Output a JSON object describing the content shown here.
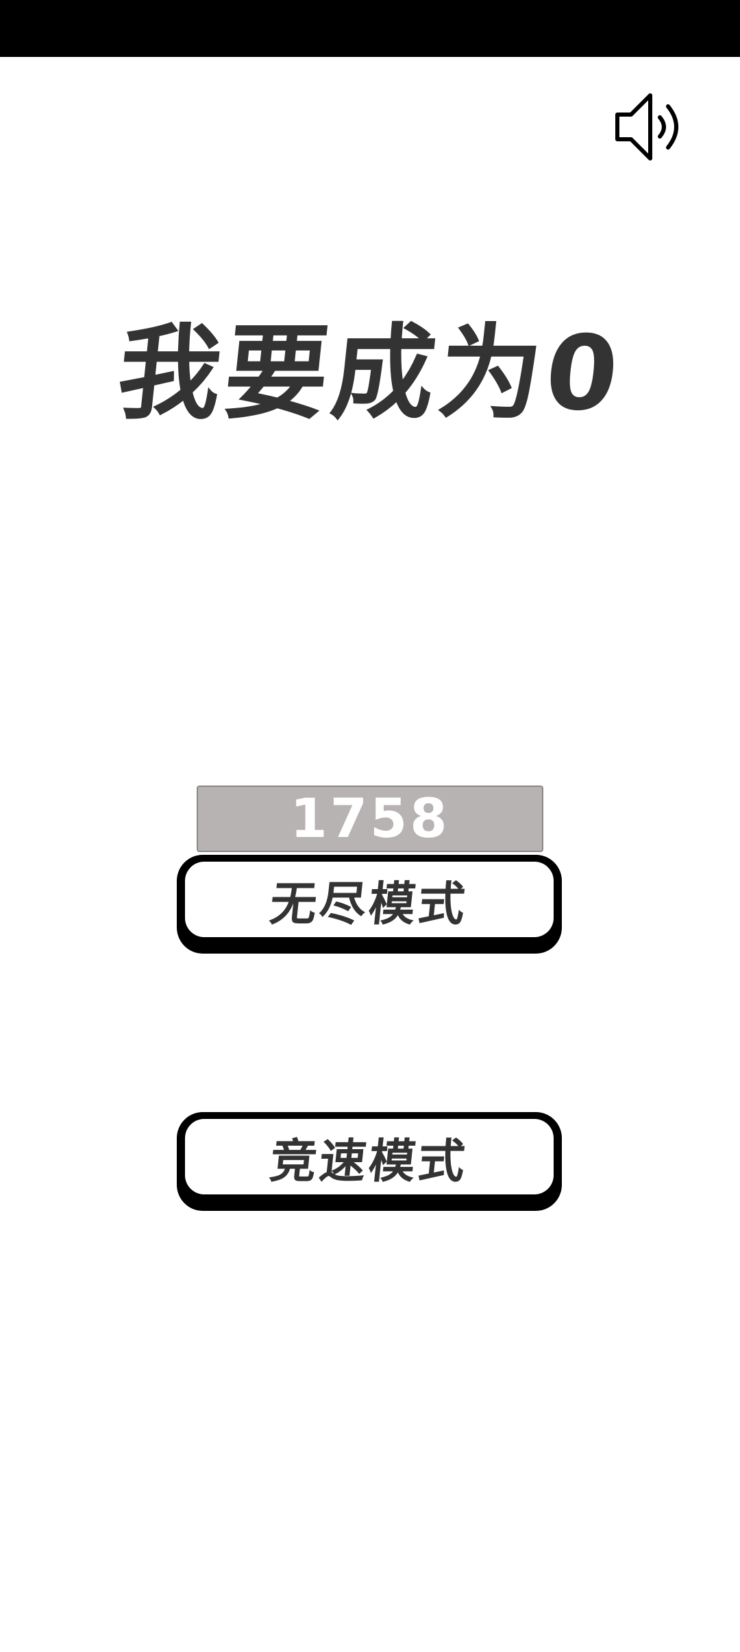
{
  "title": "我要成为0",
  "sound_icon": "speaker-volume-icon",
  "best_score": "1758",
  "buttons": {
    "endless": "无尽模式",
    "race": "竞速模式"
  },
  "colors": {
    "status_bar": "#000000",
    "text": "#333333",
    "score_bg": "#b8b3b3",
    "score_text": "#ffffff",
    "button_border": "#000000"
  }
}
